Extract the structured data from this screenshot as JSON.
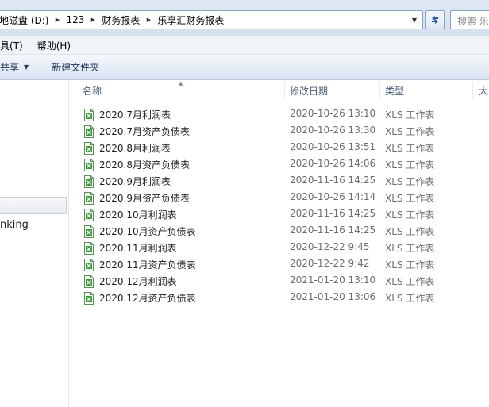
{
  "address_bar": {
    "crumbs": [
      "地磁盘 (D:)",
      "123",
      "财务报表",
      "乐享汇财务报表"
    ],
    "search_placeholder": "搜索 乐"
  },
  "menu": {
    "items": [
      "具(T)",
      "帮助(H)"
    ]
  },
  "command_bar": {
    "share_label": "共享",
    "new_folder_label": "新建文件夹"
  },
  "nav_pane": {
    "partial_label": "nking"
  },
  "columns": {
    "name": "名称",
    "date": "修改日期",
    "type": "类型",
    "size": "大"
  },
  "files": [
    {
      "name": "2020.7月利润表",
      "date": "2020-10-26 13:10",
      "type": "XLS 工作表"
    },
    {
      "name": "2020.7月资产负债表",
      "date": "2020-10-26 13:30",
      "type": "XLS 工作表"
    },
    {
      "name": "2020.8月利润表",
      "date": "2020-10-26 13:51",
      "type": "XLS 工作表"
    },
    {
      "name": "2020.8月资产负债表",
      "date": "2020-10-26 14:06",
      "type": "XLS 工作表"
    },
    {
      "name": "2020.9月利润表",
      "date": "2020-11-16 14:25",
      "type": "XLS 工作表"
    },
    {
      "name": "2020.9月资产负债表",
      "date": "2020-10-26 14:14",
      "type": "XLS 工作表"
    },
    {
      "name": "2020.10月利润表",
      "date": "2020-11-16 14:25",
      "type": "XLS 工作表"
    },
    {
      "name": "2020.10月资产负债表",
      "date": "2020-11-16 14:25",
      "type": "XLS 工作表"
    },
    {
      "name": "2020.11月利润表",
      "date": "2020-12-22 9:45",
      "type": "XLS 工作表"
    },
    {
      "name": "2020.11月资产负债表",
      "date": "2020-12-22 9:42",
      "type": "XLS 工作表"
    },
    {
      "name": "2020.12月利润表",
      "date": "2021-01-20 13:10",
      "type": "XLS 工作表"
    },
    {
      "name": "2020.12月资产负债表",
      "date": "2021-01-20 13:06",
      "type": "XLS 工作表"
    }
  ],
  "colors": {
    "address_bg": "#dfe9f5",
    "header_text": "#4c607a",
    "meta_text": "#6d6d6d",
    "xls_icon": "#3a9a3a"
  },
  "icons": {
    "file": "xls-spreadsheet-icon",
    "refresh": "refresh-icon",
    "search": "search-icon"
  }
}
